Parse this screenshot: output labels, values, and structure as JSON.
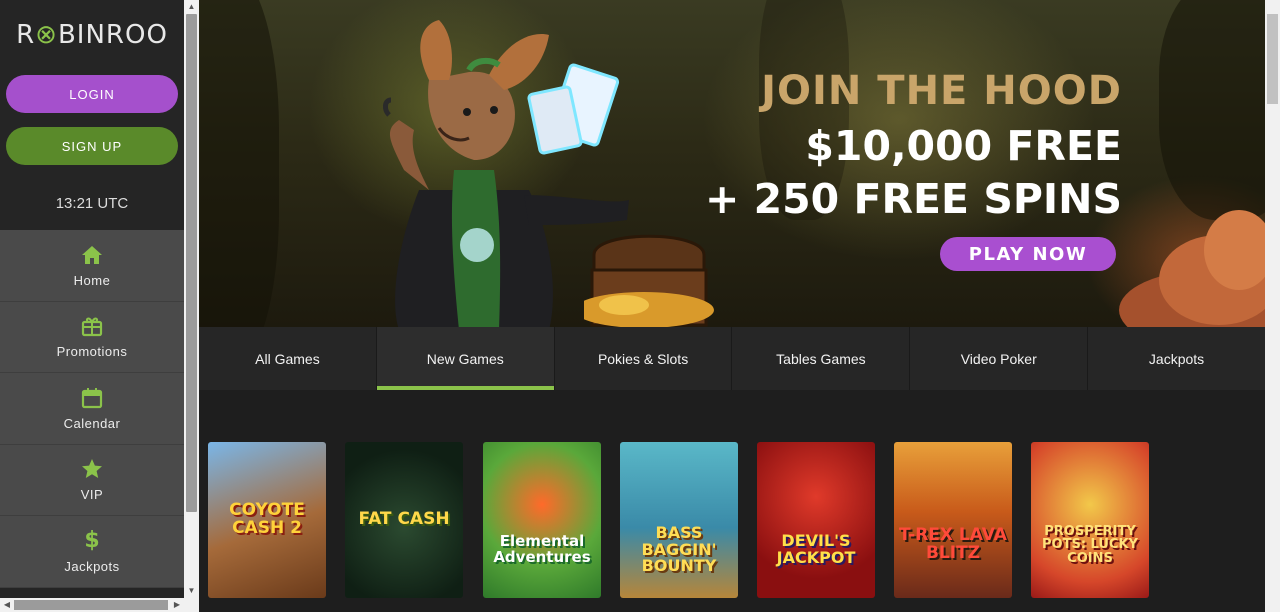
{
  "sidebar": {
    "logo": {
      "part1": "R",
      "part2": "BIN",
      "part3": "ROO"
    },
    "login_label": "LOGIN",
    "signup_label": "SIGN UP",
    "time": "13:21 UTC",
    "nav": [
      {
        "label": "Home",
        "icon": "home-icon"
      },
      {
        "label": "Promotions",
        "icon": "gift-icon"
      },
      {
        "label": "Calendar",
        "icon": "calendar-icon"
      },
      {
        "label": "VIP",
        "icon": "star-icon"
      },
      {
        "label": "Jackpots",
        "icon": "dollar-icon"
      }
    ]
  },
  "banner": {
    "line1": "JOIN THE HOOD",
    "line2": "$10,000 FREE",
    "line3": "+ 250 FREE SPINS",
    "cta": "PLAY NOW"
  },
  "tabs": [
    {
      "label": "All Games",
      "active": false
    },
    {
      "label": "New Games",
      "active": true
    },
    {
      "label": "Pokies & Slots",
      "active": false
    },
    {
      "label": "Tables Games",
      "active": false
    },
    {
      "label": "Video Poker",
      "active": false
    },
    {
      "label": "Jackpots",
      "active": false
    }
  ],
  "games": [
    {
      "title": "COYOTE CASH 2"
    },
    {
      "title": "FAT CASH"
    },
    {
      "title": "Elemental Adventures"
    },
    {
      "title": "BASS BAGGIN' BOUNTY"
    },
    {
      "title": "DEVIL'S JACKPOT"
    },
    {
      "title": "T-REX LAVA BLITZ"
    },
    {
      "title": "PROSPERITY POTS: LUCKY COINS"
    }
  ],
  "colors": {
    "accent_green": "#8bc34a",
    "accent_purple": "#a550cc",
    "gold_text": "#c9a56a"
  }
}
